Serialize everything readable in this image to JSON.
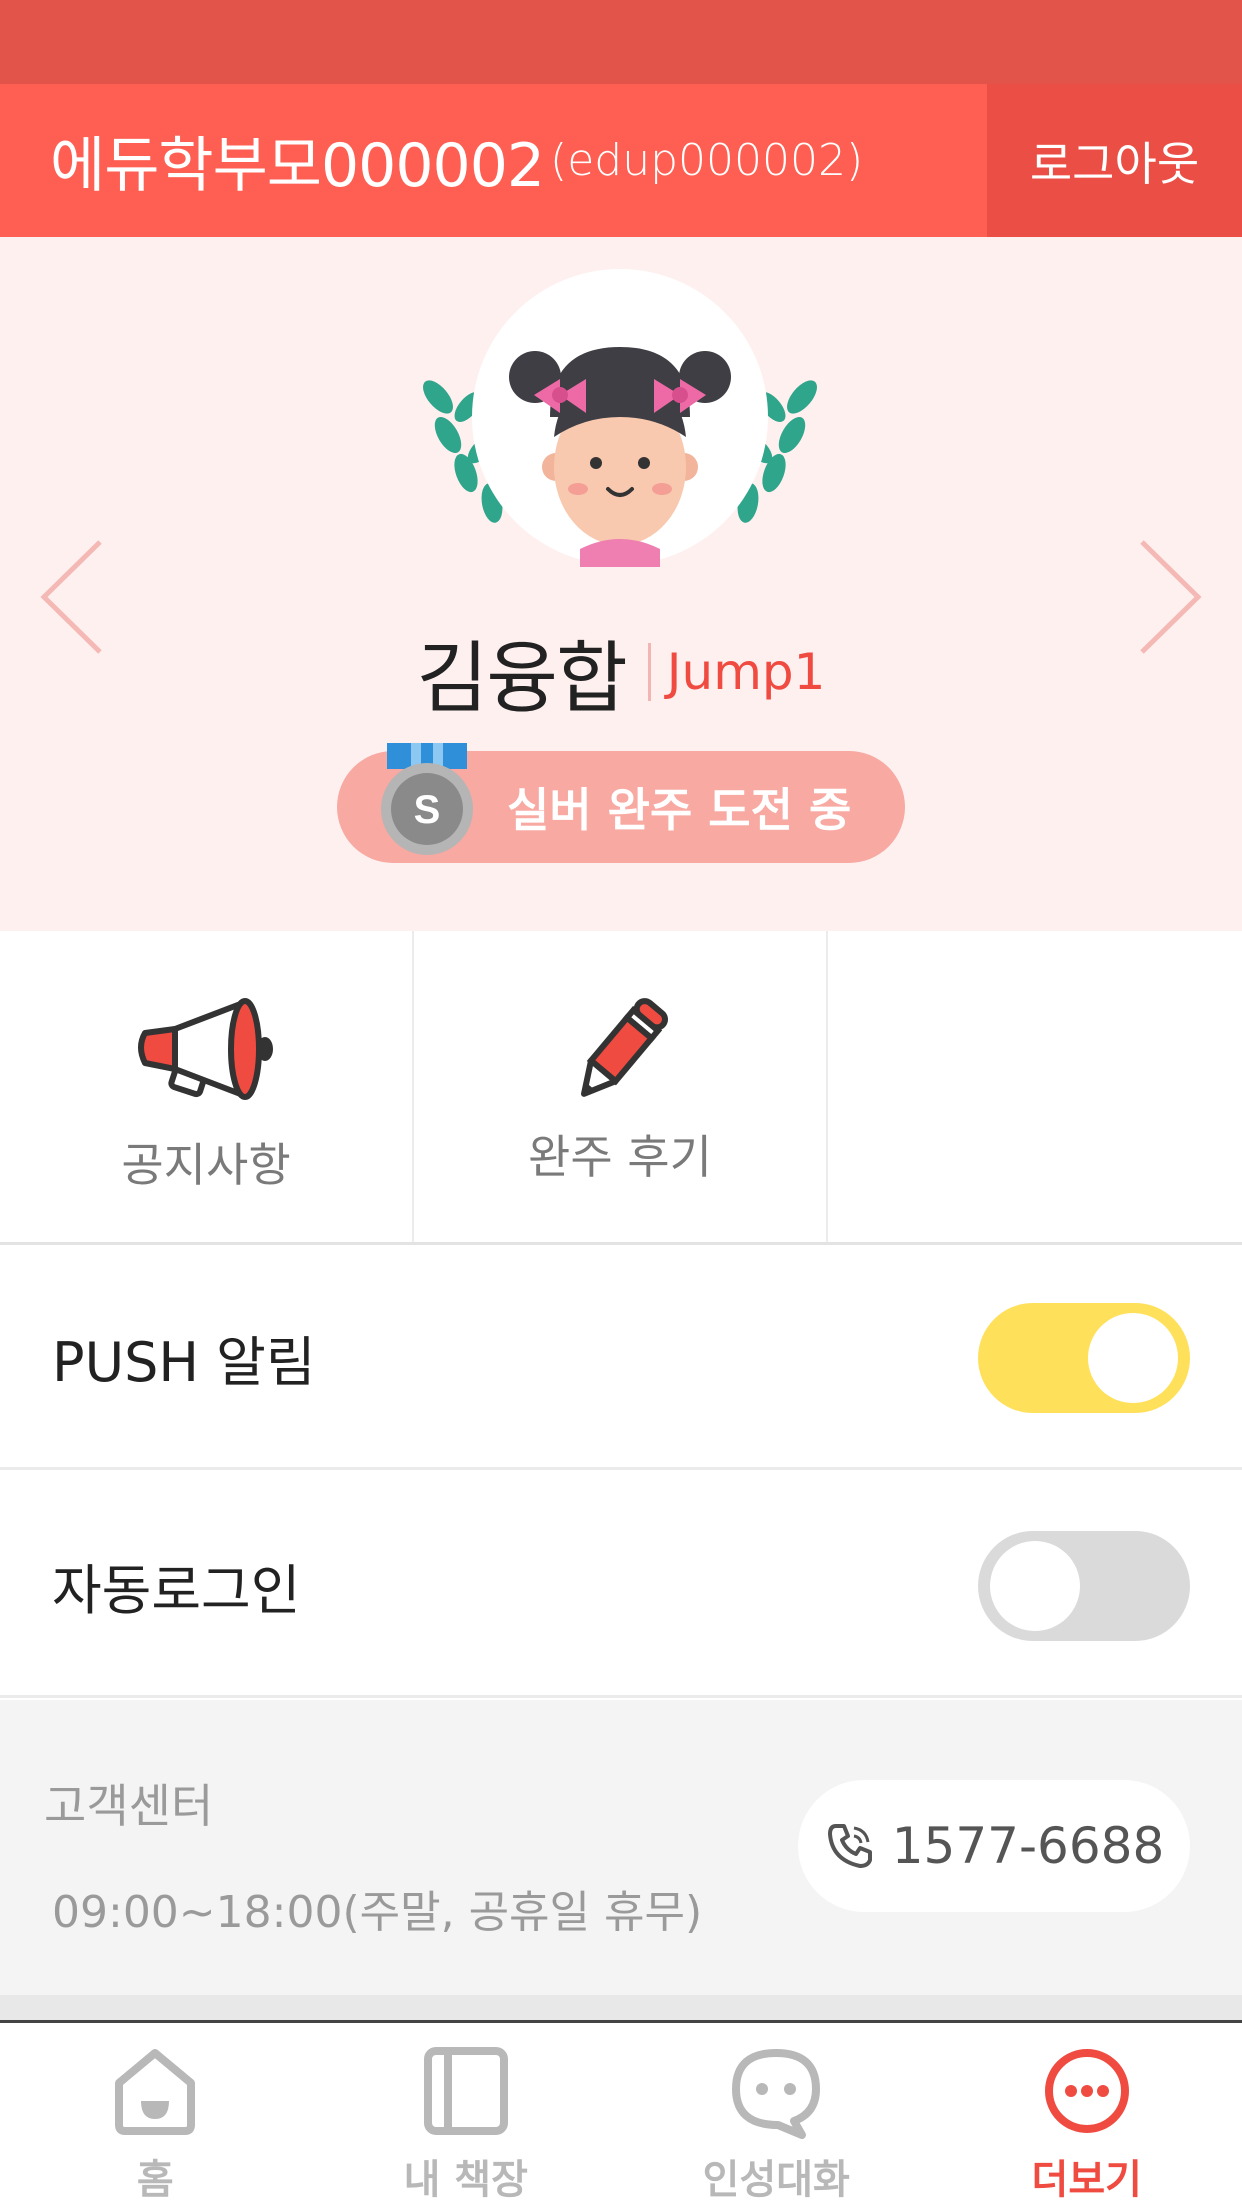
{
  "header": {
    "name": "에듀학부모000002",
    "user_id": "(edup000002)",
    "logout_label": "로그아웃"
  },
  "profile": {
    "child_name": "김융합",
    "level": "Jump1",
    "badge_letter": "S",
    "badge_label": "실버 완주 도전 중"
  },
  "menu": {
    "items": [
      {
        "label": "공지사항",
        "icon": "megaphone-icon"
      },
      {
        "label": "완주 후기",
        "icon": "pencil-icon"
      }
    ]
  },
  "settings": {
    "push": {
      "label": "PUSH 알림",
      "enabled": true
    },
    "auto_login": {
      "label": "자동로그인",
      "enabled": false
    }
  },
  "support": {
    "title": "고객센터",
    "hours": "09:00~18:00(주말, 공휴일 휴무)",
    "phone": "1577-6688"
  },
  "tabbar": {
    "tabs": [
      {
        "label": "홈",
        "icon": "home-icon",
        "active": false
      },
      {
        "label": "내 책장",
        "icon": "bookshelf-icon",
        "active": false
      },
      {
        "label": "인성대화",
        "icon": "chat-icon",
        "active": false
      },
      {
        "label": "더보기",
        "icon": "more-icon",
        "active": true
      }
    ]
  },
  "colors": {
    "header": "#ff5f52",
    "logout_bg": "#eb4e45",
    "profile_bg": "#fff0f0",
    "accent": "#ef4b41",
    "toggle_on": "#ffe05a",
    "toggle_off": "#dadada"
  }
}
